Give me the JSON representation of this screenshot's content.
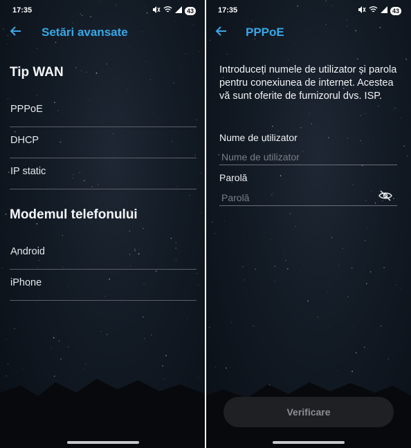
{
  "left": {
    "status": {
      "time": "17:35",
      "battery": "43"
    },
    "title": "Setări avansate",
    "sections": [
      {
        "heading": "Tip WAN",
        "items": [
          "PPPoE",
          "DHCP",
          "IP static"
        ]
      },
      {
        "heading": "Modemul telefonului",
        "items": [
          "Android",
          "iPhone"
        ]
      }
    ]
  },
  "right": {
    "status": {
      "time": "17:35",
      "battery": "43"
    },
    "title": "PPPoE",
    "description": "Introduceți numele de utilizator și parola pentru conexiunea de internet. Acestea vă sunt oferite de furnizorul dvs. ISP.",
    "username": {
      "label": "Nume de utilizator",
      "placeholder": "Nume de utilizator",
      "value": ""
    },
    "password": {
      "label": "Parolă",
      "placeholder": "Parolă",
      "value": ""
    },
    "verify_button": "Verificare"
  },
  "icons": {
    "back": "back-arrow-icon",
    "visibility": "eye-off-icon",
    "wifi": "wifi-icon",
    "signal": "signal-icon",
    "mute": "mute-icon"
  },
  "colors": {
    "accent": "#36a8e8",
    "button_bg": "#1e2024",
    "button_text": "#8b8f95"
  }
}
